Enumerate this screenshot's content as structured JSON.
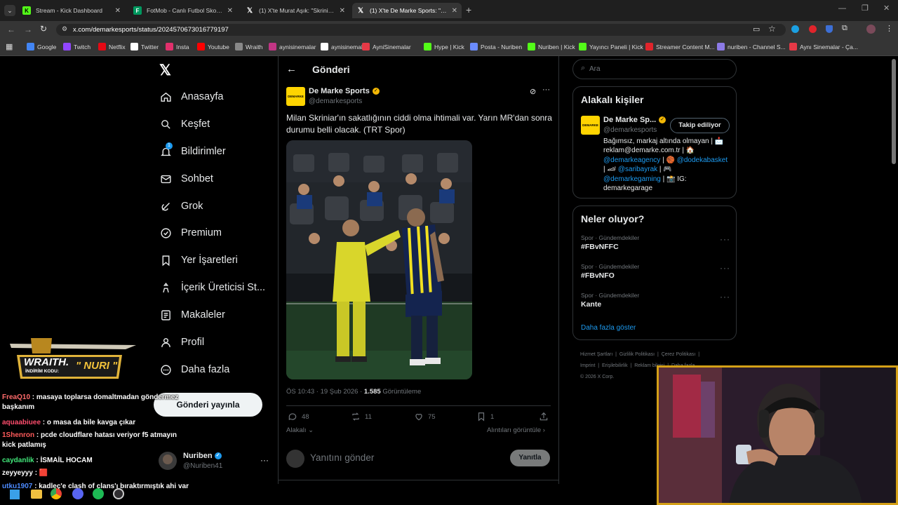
{
  "browser": {
    "tabs": [
      {
        "title": "Stream - Kick Dashboard",
        "icon": "kick-icon",
        "color": "#53fc18"
      },
      {
        "title": "FotMob - Canlı Futbol Skorlan",
        "icon": "fotmob-icon",
        "color": "#00985f"
      },
      {
        "title": "(1) X'te Murat Aşık: \"Skriniar ay",
        "icon": "x-logo-icon",
        "color": "#000000"
      },
      {
        "title": "(1) X'te De Marke Sports: \"Milan",
        "icon": "x-logo-icon",
        "color": "#000000"
      }
    ],
    "url": "x.com/demarkesports/status/2024570673016779197",
    "bookmarks": [
      "Google",
      "Twitch",
      "Netflix",
      "Twitter",
      "Insta",
      "Youtube",
      "Wraith",
      "aynisinemalar",
      "aynisinemalar",
      "AyniSinemalar",
      "Hype | Kick",
      "Posta - Nuriben",
      "Nuriben | Kick",
      "Yayıncı Paneli | Kick",
      "Streamer Content M...",
      "nuriben - Channel S...",
      "Aynı Sinemalar - Ça..."
    ]
  },
  "sidebar": {
    "items": [
      {
        "label": "Anasayfa",
        "icon": "home-icon"
      },
      {
        "label": "Keşfet",
        "icon": "search-icon"
      },
      {
        "label": "Bildirimler",
        "icon": "bell-icon",
        "badge": "1"
      },
      {
        "label": "Sohbet",
        "icon": "envelope-icon"
      },
      {
        "label": "Grok",
        "icon": "grok-icon"
      },
      {
        "label": "Premium",
        "icon": "premium-icon"
      },
      {
        "label": "Yer İşaretleri",
        "icon": "bookmark-icon"
      },
      {
        "label": "İçerik Üreticisi St...",
        "icon": "creator-icon"
      },
      {
        "label": "Makaleler",
        "icon": "articles-icon"
      },
      {
        "label": "Profil",
        "icon": "person-icon"
      },
      {
        "label": "Daha fazla",
        "icon": "more-circle-icon"
      }
    ],
    "post_button": "Gönderi yayınla",
    "account": {
      "name": "Nuriben",
      "handle": "@Nuriben41"
    }
  },
  "post": {
    "header": "Gönderi",
    "author_name": "De Marke Sports",
    "author_handle": "@demarkesports",
    "avatar_text": "DEMARKE",
    "text": "Milan Skriniar'ın sakatlığının ciddi olma ihtimali var. Yarın MR'dan sonra durumu belli olacak. (TRT Spor)",
    "time": "ÖS 10:43 · 19 Şub 2026 · ",
    "views": "1.585",
    "views_label": " Görüntüleme",
    "replies": "48",
    "reposts": "11",
    "likes": "75",
    "bookmarks": "1",
    "relevance": "Alakalı",
    "quotes_link": "Alıntıları görüntüle",
    "reply_placeholder": "Yanıtını gönder",
    "reply_button": "Yanıtla"
  },
  "right": {
    "search_placeholder": "Ara",
    "relevant_title": "Alakalı kişiler",
    "relevant_person": {
      "name": "De Marke Sp...",
      "handle": "@demarkesports",
      "follow_label": "Takip ediliyor",
      "bio_1": "Bağımsız, markaj altında olmayan | 📩",
      "bio_2": "reklam@demarke.com.tr | 🏠",
      "bio_3a": "@demarkeagency",
      "bio_3b": " | 🏀 ",
      "bio_3c": "@dodekabasket",
      "bio_4a": "| 🏎 ",
      "bio_4b": "@saribayrak",
      "bio_4c": " | 🎮",
      "bio_5a": "@demarkegaming",
      "bio_5b": " | 📸 IG:",
      "bio_6": "demarkegarage"
    },
    "trends_title": "Neler oluyor?",
    "trends": [
      {
        "meta": "Spor · Gündemdekiler",
        "name": "#FBvNFFC"
      },
      {
        "meta": "Spor · Gündemdekiler",
        "name": "#FBvNFO"
      },
      {
        "meta": "Spor · Gündemdekiler",
        "name": "Kante"
      }
    ],
    "show_more": "Daha fazla göster",
    "footer": [
      "Hizmet Şartları",
      "Gizlilik Politikası",
      "Çerez Politikası",
      "Imprint",
      "Erişilebilirlik",
      "Reklam bilgisi",
      "Daha fazla",
      "© 2026 X Corp."
    ]
  },
  "overlay": {
    "banner_title": "WRAITH.",
    "banner_code_label": "İNDİRİM KODU:",
    "banner_code": "\" NURI \"",
    "chat": [
      {
        "user": "FreaQ10",
        "color": "#ff6b6b",
        "msg": " : masaya toplarsa domaltmadan göndermez başkanım"
      },
      {
        "user": "aquaabiuee",
        "color": "#ff4d6d",
        "msg": " : o masa da bile kavga çıkar"
      },
      {
        "user": "1Shenron",
        "color": "#ff5b5b",
        "msg": " : pcde cloudflare hatası veriyor f5 atmayın kick patlamış"
      },
      {
        "user": "caydanlik",
        "color": "#43e97b",
        "msg": " : İSMAİL HOCAM"
      },
      {
        "user": "zeyyeyyy",
        "color": "#ffffff",
        "msg": " : 🟥"
      },
      {
        "user": "utku1907",
        "color": "#4d8bff",
        "msg": " : kadleç'e clash of clans'ı bıraktırmıştık ahi var"
      }
    ]
  },
  "colors": {
    "accent": "#1d9bf0",
    "verified": "#f2b705",
    "brand_yellow": "#ffd400",
    "webcam_border": "#d4a017"
  }
}
